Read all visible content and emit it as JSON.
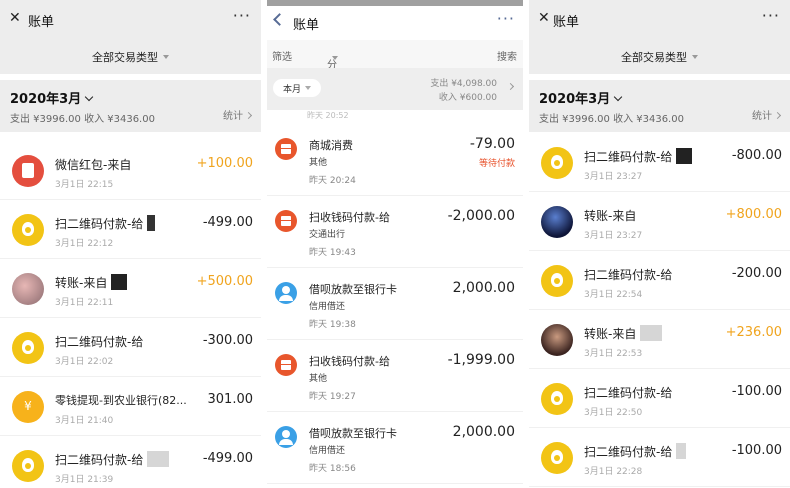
{
  "panel1": {
    "title": "账单",
    "more": "···",
    "type_filter": "全部交易类型",
    "month": "2020年3月",
    "summary": "支出 ¥3996.00 收入 ¥3436.00",
    "stats": "统计",
    "rows": [
      {
        "name": "微信红包-来自",
        "time": "3月1日 22:15",
        "amount": "+100.00",
        "icon": "red-packet-icon"
      },
      {
        "name": "扫二维码付款-给",
        "time": "3月1日 22:12",
        "amount": "-499.00",
        "icon": "money-bag-icon"
      },
      {
        "name": "转账-来自",
        "time": "3月1日 22:11",
        "amount": "+500.00",
        "icon": "user-avatar"
      },
      {
        "name": "扫二维码付款-给",
        "time": "3月1日 22:02",
        "amount": "-300.00",
        "icon": "money-bag-icon"
      },
      {
        "name": "零钱提现-到农业银行(82...",
        "time": "3月1日 21:40",
        "amount": "301.00",
        "icon": "yuan-coin-icon"
      },
      {
        "name": "扫二维码付款-给",
        "time": "3月1日 21:39",
        "amount": "-499.00",
        "icon": "money-bag-icon"
      }
    ]
  },
  "panel2": {
    "title": "账单",
    "more": "···",
    "filter": "筛选",
    "category": "分类",
    "search": "搜索",
    "month_pill": "本月",
    "expense": "支出 ¥4,098.00",
    "income": "收入 ¥600.00",
    "peek": "昨天 20:52",
    "rows": [
      {
        "name": "商城消费",
        "cat": "其他",
        "time": "昨天 20:24",
        "amount": "-79.00",
        "status": "等待付款",
        "icon": "shop-icon"
      },
      {
        "name": "扫收钱码付款-给",
        "cat": "交通出行",
        "time": "昨天 19:43",
        "amount": "-2,000.00",
        "status": "",
        "icon": "shop-icon"
      },
      {
        "name": "借呗放款至银行卡",
        "cat": "信用借还",
        "time": "昨天 19:38",
        "amount": "2,000.00",
        "status": "",
        "icon": "user-icon"
      },
      {
        "name": "扫收钱码付款-给",
        "cat": "其他",
        "time": "昨天 19:27",
        "amount": "-1,999.00",
        "status": "",
        "icon": "shop-icon"
      },
      {
        "name": "借呗放款至银行卡",
        "cat": "信用借还",
        "time": "昨天 18:56",
        "amount": "2,000.00",
        "status": "",
        "icon": "user-icon"
      }
    ]
  },
  "panel3": {
    "title": "账单",
    "more": "···",
    "type_filter": "全部交易类型",
    "month": "2020年3月",
    "summary": "支出 ¥3996.00 收入 ¥3436.00",
    "stats": "统计",
    "rows": [
      {
        "name": "扫二维码付款-给",
        "time": "3月1日 23:27",
        "amount": "-800.00",
        "icon": "money-bag-icon"
      },
      {
        "name": "转账-来自",
        "time": "3月1日 23:27",
        "amount": "+800.00",
        "icon": "user-avatar"
      },
      {
        "name": "扫二维码付款-给",
        "time": "3月1日 22:54",
        "amount": "-200.00",
        "icon": "money-bag-icon"
      },
      {
        "name": "转账-来自",
        "time": "3月1日 22:53",
        "amount": "+236.00",
        "icon": "user-avatar"
      },
      {
        "name": "扫二维码付款-给",
        "time": "3月1日 22:50",
        "amount": "-100.00",
        "icon": "money-bag-icon"
      },
      {
        "name": "扫二维码付款-给",
        "time": "3月1日 22:28",
        "amount": "-100.00",
        "icon": "money-bag-icon"
      }
    ]
  }
}
